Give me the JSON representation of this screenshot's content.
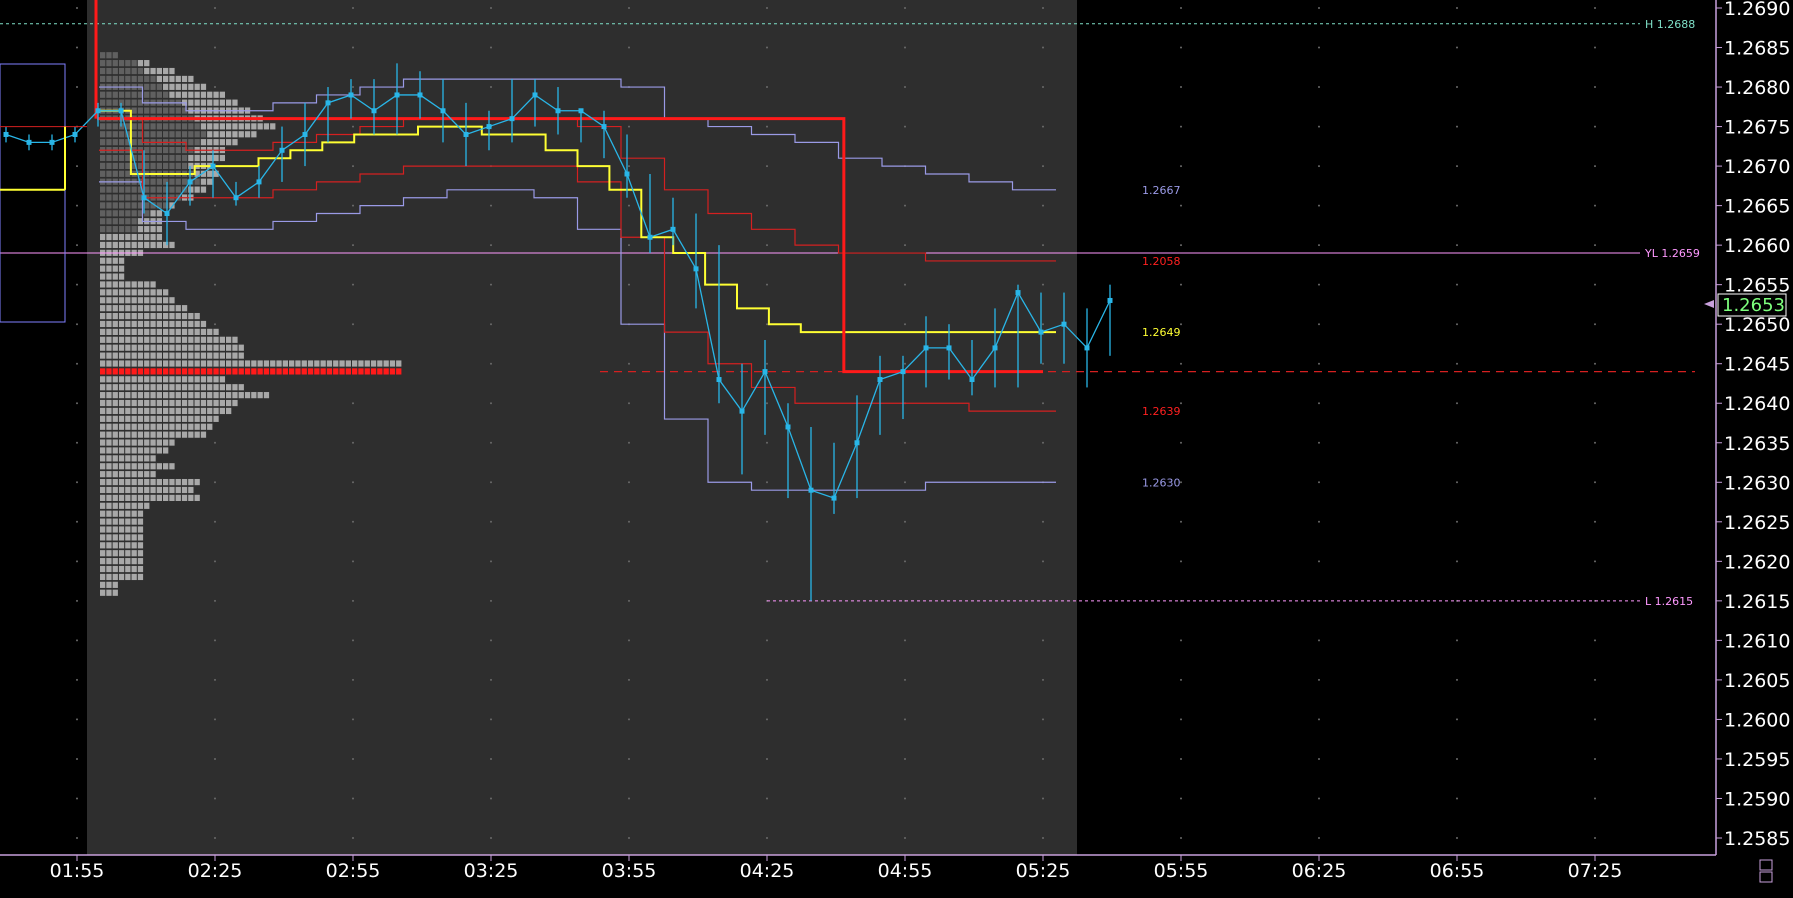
{
  "chart_data": {
    "type": "line",
    "title": "",
    "xlabel": "",
    "ylabel": "",
    "ylim": [
      1.2585,
      1.2691
    ],
    "x_ticks": [
      "01:55",
      "02:25",
      "02:55",
      "03:25",
      "03:55",
      "04:25",
      "04:55",
      "05:25",
      "05:55",
      "06:25",
      "06:55",
      "07:25"
    ],
    "y_ticks": [
      "1.2690",
      "1.2685",
      "1.2680",
      "1.2675",
      "1.2670",
      "1.2665",
      "1.2660",
      "1.2655",
      "1.2650",
      "1.2645",
      "1.2640",
      "1.2635",
      "1.2630",
      "1.2625",
      "1.2620",
      "1.2615",
      "1.2610",
      "1.2605",
      "1.2600",
      "1.2595",
      "1.2590",
      "1.2585"
    ],
    "last_price": "1.2653",
    "grid": true,
    "legend": "none",
    "colors": {
      "background": "#000000",
      "session_bg": "#2e2e2e",
      "axis": "#c8a0dc",
      "price": "#29b6e8",
      "vwap": "#ffff33",
      "band_inner": "#d42020",
      "band_outer": "#9a9ae6",
      "pivot": "#ff1a1a",
      "hline": "#ff99ff",
      "high_line": "#7fe0c8",
      "profile_light": "#a8a8a8",
      "profile_dark": "#606060"
    },
    "hlines": [
      {
        "label": "H 1.2688",
        "value": 1.2688,
        "color": "#7fe0c8"
      },
      {
        "label": "YL 1.2659",
        "value": 1.2659,
        "color": "#ff99ff"
      },
      {
        "label": "L 1.2615",
        "value": 1.2615,
        "color": "#ff99ff"
      }
    ],
    "band_labels": [
      {
        "label": "1.2667",
        "value": 1.2667,
        "color": "#9a9ae6"
      },
      {
        "label": "1.2058",
        "value": 1.2658,
        "color": "#ff2020"
      },
      {
        "label": "1.2649",
        "value": 1.2649,
        "color": "#ffff33"
      },
      {
        "label": "1.2639",
        "value": 1.2639,
        "color": "#ff2020"
      },
      {
        "label": "1.2630",
        "value": 1.263,
        "color": "#9a9ae6"
      }
    ],
    "price_series": {
      "name": "",
      "x": [
        "01:35",
        "01:40",
        "01:45",
        "01:50",
        "01:55",
        "02:00",
        "02:05",
        "02:10",
        "02:15",
        "02:20",
        "02:25",
        "02:30",
        "02:35",
        "02:40",
        "02:45",
        "02:50",
        "02:55",
        "03:00",
        "03:05",
        "03:10",
        "03:15",
        "03:20",
        "03:25",
        "03:30",
        "03:35",
        "03:40",
        "03:45",
        "03:50",
        "03:55",
        "04:00",
        "04:05",
        "04:10",
        "04:15",
        "04:20",
        "04:25",
        "04:30",
        "04:35",
        "04:40",
        "04:45",
        "04:50",
        "04:55",
        "05:00",
        "05:05",
        "05:10",
        "05:15",
        "05:20",
        "05:25"
      ],
      "close": [
        1.2674,
        1.2673,
        1.2673,
        1.2674,
        1.2677,
        1.2677,
        1.2666,
        1.2664,
        1.2668,
        1.267,
        1.2666,
        1.2668,
        1.2672,
        1.2674,
        1.2678,
        1.2679,
        1.2677,
        1.2679,
        1.2679,
        1.2677,
        1.2674,
        1.2675,
        1.2676,
        1.2679,
        1.2677,
        1.2677,
        1.2675,
        1.2669,
        1.2661,
        1.2662,
        1.2657,
        1.2643,
        1.2639,
        1.2644,
        1.2637,
        1.2629,
        1.2628,
        1.2635,
        1.2643,
        1.2644,
        1.2647,
        1.2647,
        1.2643,
        1.2647,
        1.2654,
        1.2649,
        1.265,
        1.2647,
        1.2653
      ],
      "high": [
        1.2675,
        1.2674,
        1.2674,
        1.2675,
        1.2678,
        1.2678,
        1.2672,
        1.2668,
        1.267,
        1.2672,
        1.2668,
        1.267,
        1.2675,
        1.2678,
        1.268,
        1.2681,
        1.2681,
        1.2683,
        1.2682,
        1.2681,
        1.2678,
        1.2677,
        1.2681,
        1.2681,
        1.268,
        1.2677,
        1.2677,
        1.2674,
        1.2669,
        1.2666,
        1.2664,
        1.266,
        1.2645,
        1.2648,
        1.264,
        1.2637,
        1.2635,
        1.2641,
        1.2646,
        1.2646,
        1.2651,
        1.265,
        1.2648,
        1.2652,
        1.2655,
        1.2654,
        1.2654,
        1.2652,
        1.2655
      ],
      "low": [
        1.2673,
        1.2672,
        1.2672,
        1.2673,
        1.2675,
        1.2675,
        1.2664,
        1.266,
        1.2665,
        1.2666,
        1.2665,
        1.2666,
        1.2668,
        1.267,
        1.2673,
        1.2676,
        1.2674,
        1.2674,
        1.2676,
        1.2673,
        1.267,
        1.2672,
        1.2673,
        1.2675,
        1.2674,
        1.2673,
        1.2671,
        1.2666,
        1.2659,
        1.266,
        1.2652,
        1.264,
        1.2631,
        1.2636,
        1.2628,
        1.2615,
        1.2626,
        1.2628,
        1.2636,
        1.2638,
        1.2642,
        1.2643,
        1.2641,
        1.2642,
        1.2642,
        1.2645,
        1.2645,
        1.2642,
        1.2646
      ]
    },
    "vwap_series": [
      [
        1.2667,
        1.2677,
        1.2669,
        1.2669,
        1.267,
        1.267,
        1.2671,
        1.2672,
        1.2673,
        1.2674,
        1.2674,
        1.2675,
        1.2675,
        1.2674,
        1.2674,
        1.2672,
        1.267,
        1.2667,
        1.2661,
        1.2659,
        1.2655,
        1.2652,
        1.265,
        1.2649,
        1.2649,
        1.2649,
        1.2649,
        1.2649,
        1.2649,
        1.2649,
        1.2649
      ]
    ],
    "upper_outer": [
      1.268,
      1.2678,
      1.2677,
      1.2677,
      1.2678,
      1.2679,
      1.268,
      1.2681,
      1.2681,
      1.2681,
      1.2681,
      1.2681,
      1.268,
      1.2676,
      1.2675,
      1.2674,
      1.2673,
      1.2671,
      1.267,
      1.2669,
      1.2668,
      1.2667
    ],
    "upper_inner": [
      1.2676,
      1.2673,
      1.2672,
      1.2672,
      1.2673,
      1.2674,
      1.2675,
      1.2676,
      1.2676,
      1.2676,
      1.2676,
      1.2675,
      1.2671,
      1.2667,
      1.2664,
      1.2662,
      1.266,
      1.2659,
      1.2659,
      1.2658,
      1.2658,
      1.2658
    ],
    "lower_inner": [
      1.2672,
      1.2666,
      1.2666,
      1.2666,
      1.2667,
      1.2668,
      1.2669,
      1.267,
      1.267,
      1.267,
      1.267,
      1.2668,
      1.2661,
      1.2649,
      1.2645,
      1.2642,
      1.264,
      1.264,
      1.264,
      1.264,
      1.2639,
      1.2639
    ],
    "lower_outer": [
      1.2668,
      1.2663,
      1.2662,
      1.2662,
      1.2663,
      1.2664,
      1.2665,
      1.2666,
      1.2667,
      1.2667,
      1.2666,
      1.2662,
      1.265,
      1.2638,
      1.263,
      1.2629,
      1.2629,
      1.2629,
      1.2629,
      1.263,
      1.263,
      1.263
    ],
    "pivot_series": [
      1.2676,
      1.2676,
      1.2676,
      1.2676,
      1.2676,
      1.2676,
      1.2676,
      1.2676,
      1.2676,
      1.2676,
      1.2676,
      1.2676,
      1.2676,
      1.2676,
      1.2676,
      1.2644,
      1.2644,
      1.2644,
      1.2644
    ],
    "poc_value": 1.2644,
    "volume_profile": {
      "prices": [
        1.2684,
        1.2683,
        1.2682,
        1.2681,
        1.268,
        1.2679,
        1.2678,
        1.2677,
        1.2676,
        1.2675,
        1.2674,
        1.2673,
        1.2672,
        1.2671,
        1.267,
        1.2669,
        1.2668,
        1.2667,
        1.2666,
        1.2665,
        1.2664,
        1.2663,
        1.2662,
        1.2661,
        1.266,
        1.2659,
        1.2658,
        1.2657,
        1.2656,
        1.2655,
        1.2654,
        1.2653,
        1.2652,
        1.2651,
        1.265,
        1.2649,
        1.2648,
        1.2647,
        1.2646,
        1.2645,
        1.2644,
        1.2643,
        1.2642,
        1.2641,
        1.264,
        1.2639,
        1.2638,
        1.2637,
        1.2636,
        1.2635,
        1.2634,
        1.2633,
        1.2632,
        1.2631,
        1.263,
        1.2629,
        1.2628,
        1.2627,
        1.2626,
        1.2625,
        1.2624,
        1.2623,
        1.2622,
        1.2621,
        1.262,
        1.2619,
        1.2618,
        1.2617,
        1.2616
      ],
      "counts": [
        3,
        8,
        12,
        15,
        17,
        20,
        22,
        24,
        26,
        28,
        25,
        22,
        20,
        20,
        18,
        19,
        18,
        17,
        15,
        12,
        10,
        10,
        10,
        10,
        12,
        7,
        4,
        4,
        4,
        9,
        11,
        12,
        14,
        16,
        17,
        19,
        22,
        23,
        23,
        48,
        48,
        20,
        23,
        27,
        22,
        21,
        19,
        18,
        17,
        12,
        11,
        9,
        12,
        9,
        16,
        15,
        16,
        8,
        7,
        7,
        7,
        7,
        7,
        7,
        7,
        7,
        7,
        3,
        3
      ],
      "session_counts": [
        5,
        6,
        7,
        9,
        10,
        11,
        13,
        14,
        15,
        16,
        17,
        16,
        15,
        14,
        14,
        15,
        16,
        14,
        13,
        11,
        8,
        6,
        6,
        4,
        2,
        1,
        0,
        0,
        0,
        0,
        0,
        0,
        0,
        0,
        0,
        0,
        0,
        0,
        0,
        0,
        0,
        0,
        0,
        0,
        0,
        0,
        0,
        0,
        0,
        0,
        0,
        0,
        0,
        0,
        0,
        0,
        0,
        0,
        0,
        0,
        0,
        0,
        0,
        0,
        0,
        0,
        0,
        0,
        0
      ]
    }
  }
}
